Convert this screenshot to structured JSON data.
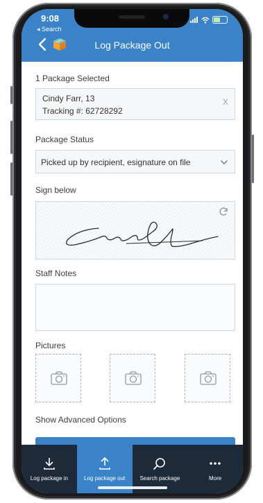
{
  "status_bar": {
    "time": "9:08",
    "back_label": "◂ Search"
  },
  "nav": {
    "title": "Log Package Out"
  },
  "packages": {
    "selected_label": "1 Package Selected",
    "recipient": "Cindy Farr, 13",
    "tracking": "Tracking #: 62728292",
    "remove_symbol": "X"
  },
  "status": {
    "label": "Package Status",
    "value": "Picked up by recipient, esignature on file"
  },
  "signature": {
    "label": "Sign below"
  },
  "notes": {
    "label": "Staff Notes",
    "value": ""
  },
  "pictures": {
    "label": "Pictures"
  },
  "advanced": {
    "label": "Show Advanced Options"
  },
  "tabs": [
    {
      "label": "Log package in",
      "icon": "download-icon"
    },
    {
      "label": "Log package out",
      "icon": "upload-icon"
    },
    {
      "label": "Search package",
      "icon": "search-icon"
    },
    {
      "label": "More",
      "icon": "more-icon"
    }
  ],
  "colors": {
    "accent": "#3a83c9",
    "tabbar": "#1c2a3a"
  }
}
